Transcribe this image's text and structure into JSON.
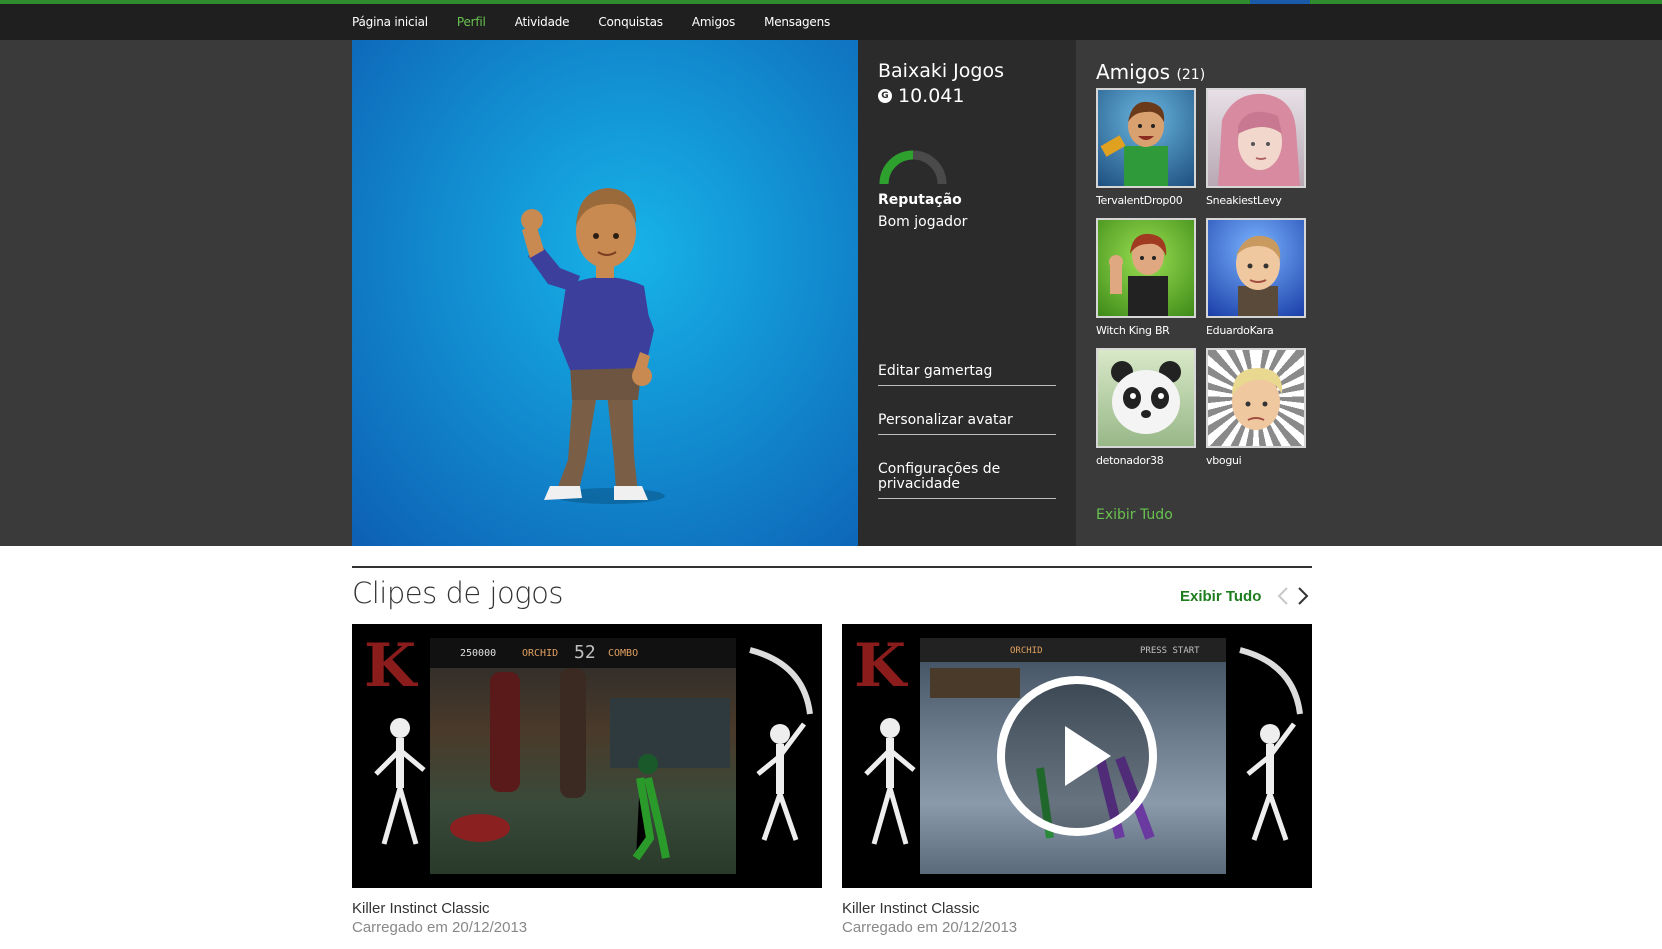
{
  "nav": {
    "items": [
      {
        "label": "Página inicial",
        "active": false
      },
      {
        "label": "Perfil",
        "active": true
      },
      {
        "label": "Atividade",
        "active": false
      },
      {
        "label": "Conquistas",
        "active": false
      },
      {
        "label": "Amigos",
        "active": false
      },
      {
        "label": "Mensagens",
        "active": false
      }
    ]
  },
  "profile": {
    "gamertag": "Baixaki Jogos",
    "gamerscore_icon": "G",
    "gamerscore": "10.041",
    "reputation_label": "Reputação",
    "reputation_value": "Bom jogador",
    "reputation_level": 0.5,
    "links": {
      "edit_gamertag": "Editar gamertag",
      "customize_avatar": "Personalizar avatar",
      "privacy_settings": "Configurações de privacidade"
    }
  },
  "friends": {
    "title": "Amigos",
    "count": "(21)",
    "view_all": "Exibir Tudo",
    "items": [
      {
        "name": "TervalentDrop00"
      },
      {
        "name": "SneakiestLevy"
      },
      {
        "name": "Witch King BR"
      },
      {
        "name": "EduardoKara"
      },
      {
        "name": "detonador38"
      },
      {
        "name": "vbogui"
      }
    ]
  },
  "clips": {
    "title": "Clipes de jogos",
    "view_all": "Exibir Tudo",
    "prev_icon": "chevron-left-icon",
    "next_icon": "chevron-right-icon",
    "items": [
      {
        "title": "Killer Instinct Classic",
        "date": "Carregado em 20/12/2013",
        "hud": {
          "score": "250000",
          "player": "ORCHID",
          "timer": "52",
          "p2": "COMBO"
        }
      },
      {
        "title": "Killer Instinct Classic",
        "date": "Carregado em 20/12/2013",
        "hud": {
          "p1": "ORCHID",
          "p2": "PRESS START"
        }
      }
    ]
  },
  "colors": {
    "accent_green": "#68c24f",
    "dark_green": "#1e7d1e",
    "nav_bg": "#1f1f1f",
    "hero_bg": "#3a3a3a",
    "info_bg": "#2b2b2b"
  }
}
